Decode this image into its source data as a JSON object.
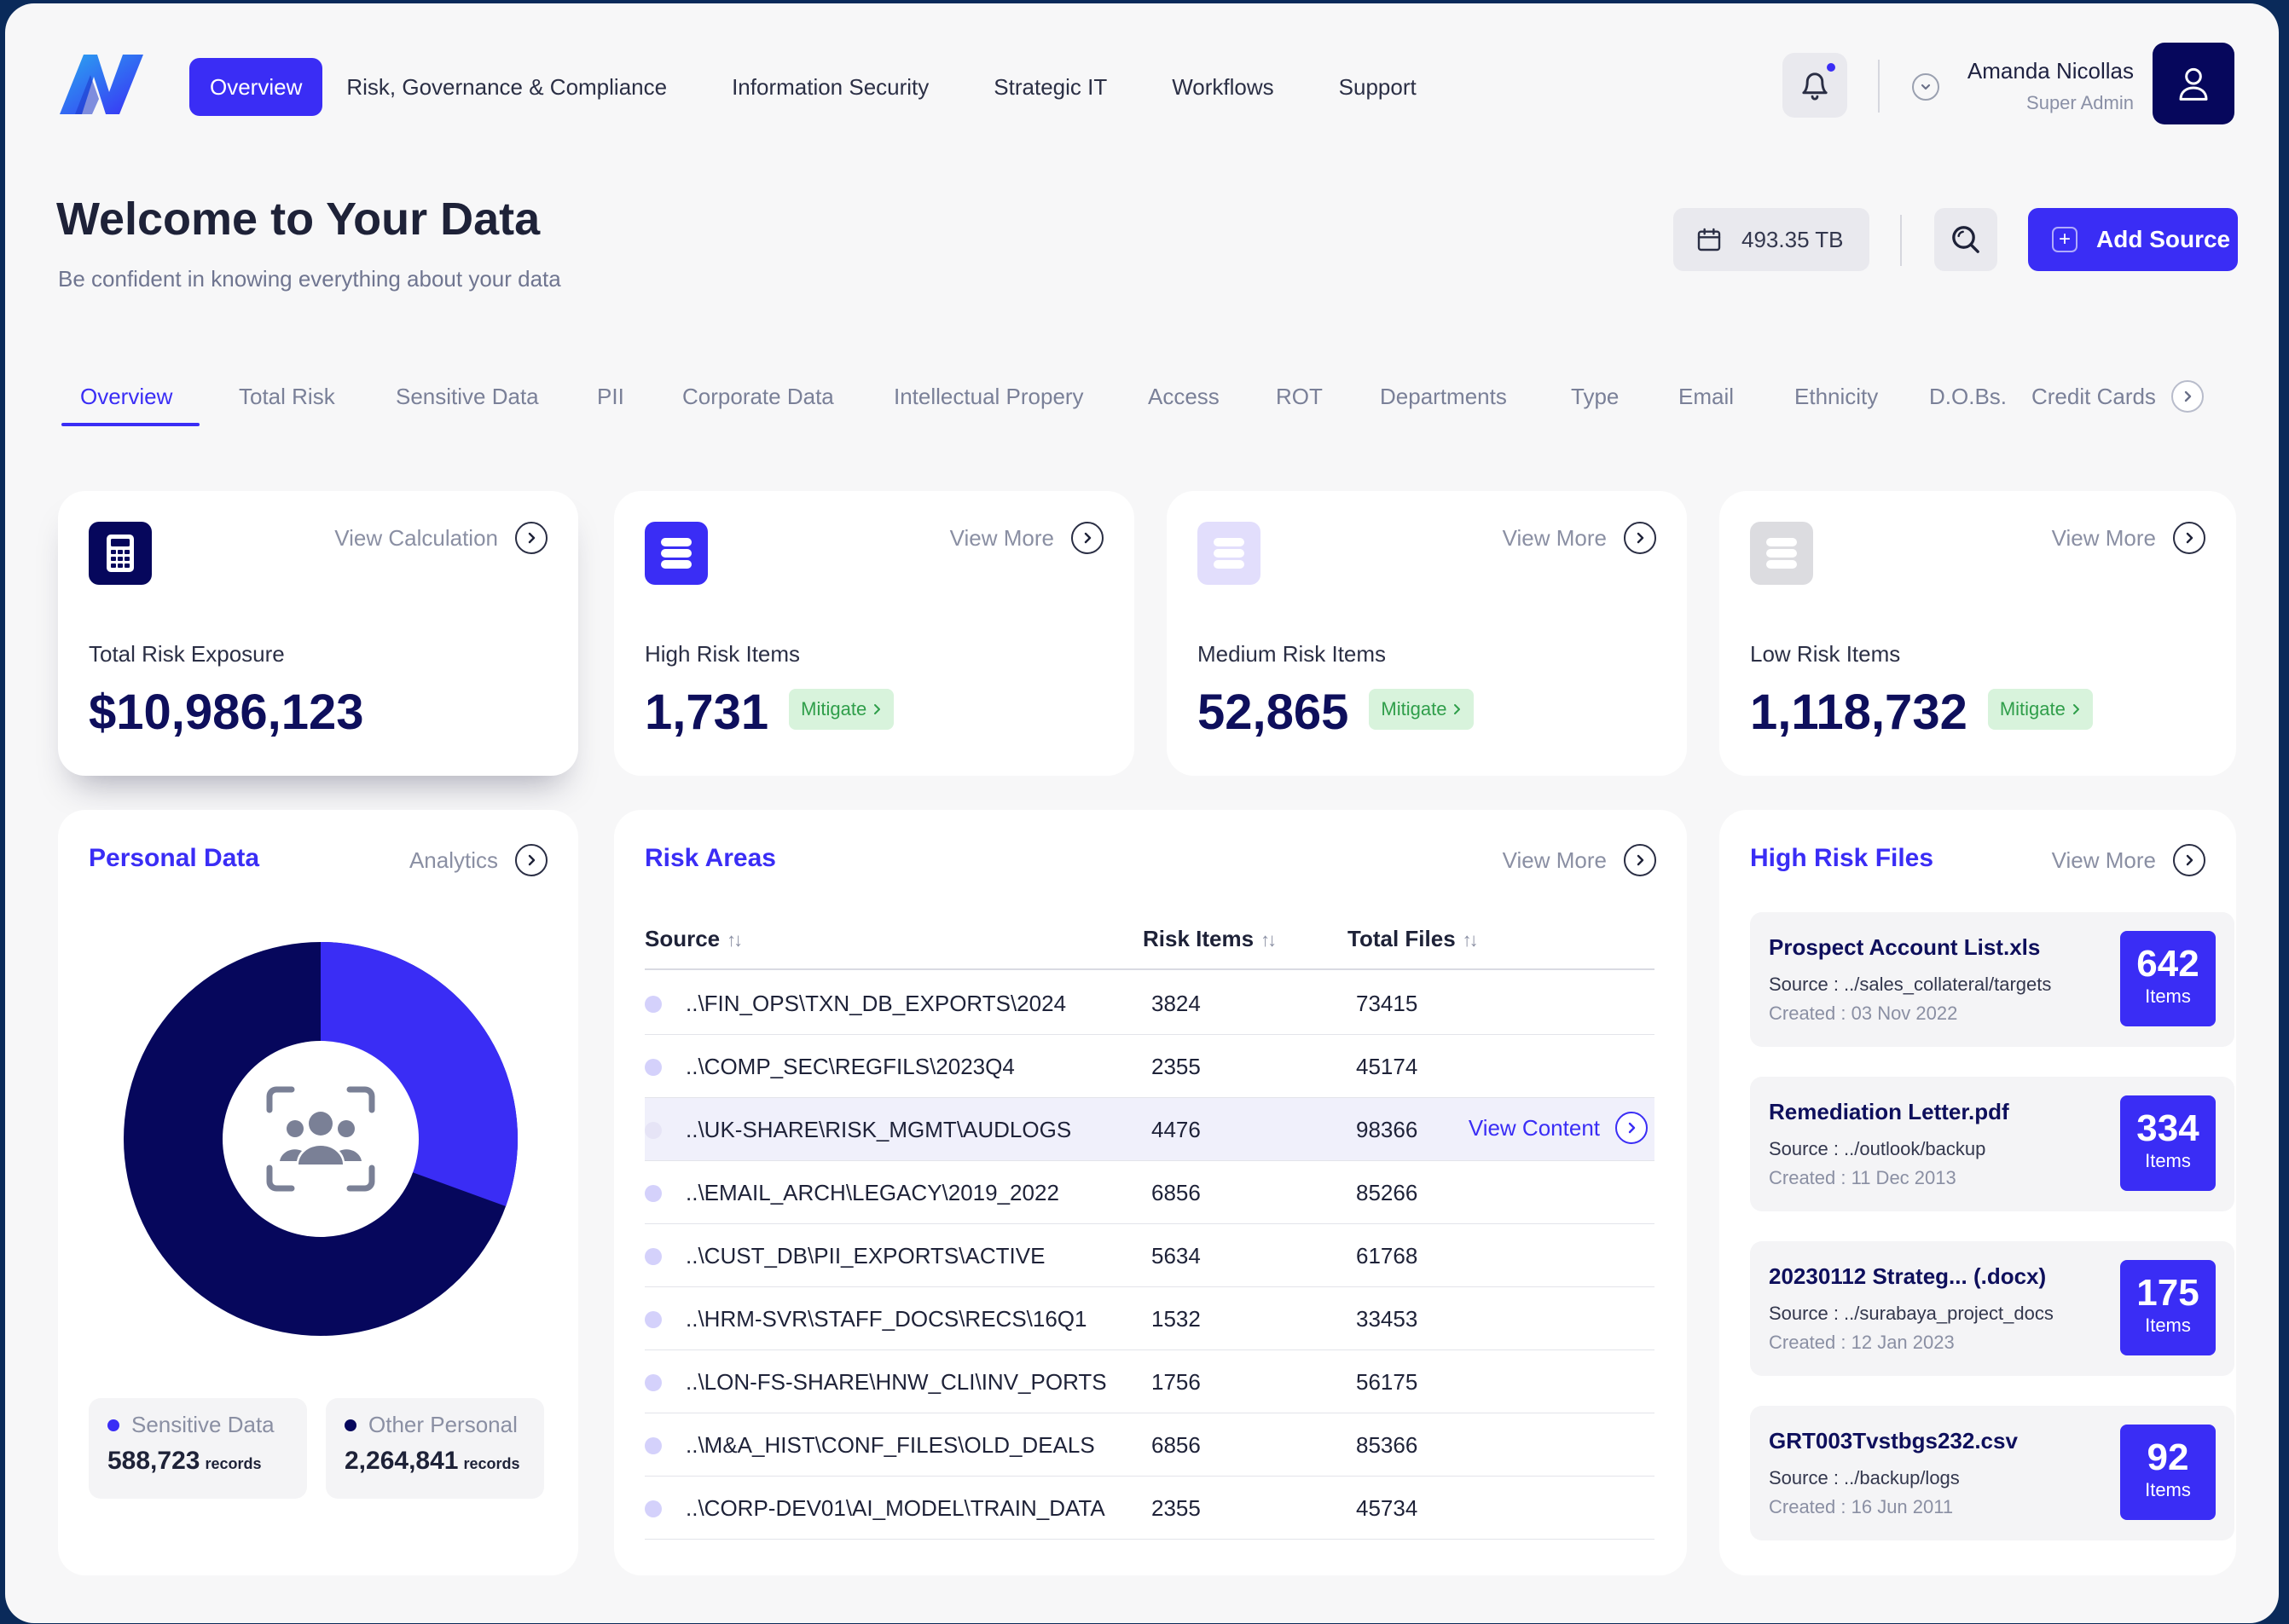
{
  "nav": {
    "items": [
      "Overview",
      "Risk, Governance & Compliance",
      "Information Security",
      "Strategic IT",
      "Workflows",
      "Support"
    ],
    "active_index": 0
  },
  "user": {
    "name": "Amanda Nicollas",
    "role": "Super Admin"
  },
  "header": {
    "title": "Welcome to Your Data",
    "subtitle": "Be confident in knowing everything about your data",
    "storage": "493.35 TB",
    "add_source": "Add Source"
  },
  "subtabs": {
    "items": [
      "Overview",
      "Total Risk",
      "Sensitive Data",
      "PII",
      "Corporate Data",
      "Intellectual Propery",
      "Access",
      "ROT",
      "Departments",
      "Type",
      "Email",
      "Ethnicity",
      "D.O.Bs.",
      "Credit Cards"
    ],
    "active_index": 0
  },
  "stats": [
    {
      "link": "View Calculation",
      "label": "Total Risk Exposure",
      "value": "$10,986,123",
      "icon": "calculator-icon",
      "color": "#06075c"
    },
    {
      "link": "View More",
      "label": "High Risk Items",
      "value": "1,731",
      "action": "Mitigate",
      "icon": "stack-icon",
      "color": "#3a2df5"
    },
    {
      "link": "View More",
      "label": "Medium Risk Items",
      "value": "52,865",
      "action": "Mitigate",
      "icon": "stack-icon",
      "color": "#e2defc"
    },
    {
      "link": "View More",
      "label": "Low Risk Items",
      "value": "1,118,732",
      "action": "Mitigate",
      "icon": "stack-icon",
      "color": "#dcdce0"
    }
  ],
  "personal": {
    "title": "Personal Data",
    "link": "Analytics",
    "legend": [
      {
        "label": "Sensitive Data",
        "value": "588,723",
        "unit": "records",
        "color": "#3a2df5"
      },
      {
        "label": "Other Personal",
        "value": "2,264,841",
        "unit": "records",
        "color": "#06075c"
      }
    ]
  },
  "risk_areas": {
    "title": "Risk Areas",
    "link": "View More",
    "columns": [
      "Source",
      "Risk Items",
      "Total Files"
    ],
    "row_action": "View Content",
    "rows": [
      [
        "..\\FIN_OPS\\TXN_DB_EXPORTS\\2024",
        "3824",
        "73415"
      ],
      [
        "..\\COMP_SEC\\REGFILS\\2023Q4",
        "2355",
        "45174"
      ],
      [
        "..\\UK-SHARE\\RISK_MGMT\\AUDLOGS",
        "4476",
        "98366"
      ],
      [
        "..\\EMAIL_ARCH\\LEGACY\\2019_2022",
        "6856",
        "85266"
      ],
      [
        "..\\CUST_DB\\PII_EXPORTS\\ACTIVE",
        "5634",
        "61768"
      ],
      [
        "..\\HRM-SVR\\STAFF_DOCS\\RECS\\16Q1",
        "1532",
        "33453"
      ],
      [
        "..\\LON-FS-SHARE\\HNW_CLI\\INV_PORTS",
        "1756",
        "56175"
      ],
      [
        "..\\M&A_HIST\\CONF_FILES\\OLD_DEALS",
        "6856",
        "85366"
      ],
      [
        "..\\CORP-DEV01\\AI_MODEL\\TRAIN_DATA",
        "2355",
        "45734"
      ]
    ],
    "highlighted_row": 2
  },
  "high_risk_files": {
    "title": "High Risk Files",
    "link": "View More",
    "files": [
      {
        "name": "Prospect Account List.xls",
        "source": "Source : ../sales_collateral/targets",
        "created": "Created : 03 Nov 2022",
        "count": "642",
        "unit": "Items"
      },
      {
        "name": "Remediation Letter.pdf",
        "source": "Source : ../outlook/backup",
        "created": "Created : 11 Dec 2013",
        "count": "334",
        "unit": "Items"
      },
      {
        "name": "20230112 Strateg... (.docx)",
        "source": "Source : ../surabaya_project_docs",
        "created": "Created : 12 Jan 2023",
        "count": "175",
        "unit": "Items"
      },
      {
        "name": "GRT003Tvstbgs232.csv",
        "source": "Source : ../backup/logs",
        "created": "Created : 16 Jun 2011",
        "count": "92",
        "unit": "Items"
      }
    ]
  },
  "colors": {
    "accent": "#3a2df5",
    "navy": "#06075c",
    "success_bg": "#d8f3dc",
    "success_text": "#2f9e4a"
  }
}
